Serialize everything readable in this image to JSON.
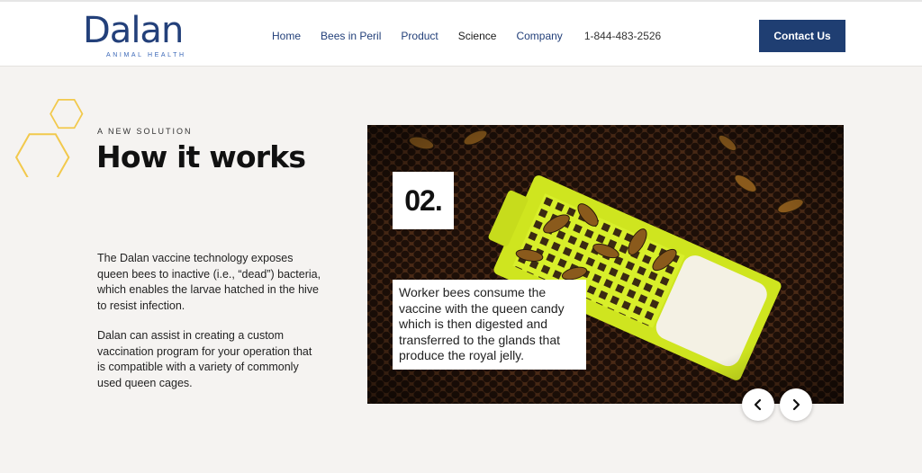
{
  "brand": {
    "name": "Dalan",
    "tagline": "ANIMAL HEALTH",
    "color": "#23407a"
  },
  "nav": {
    "items": [
      "Home",
      "Bees in Peril",
      "Product",
      "Science",
      "Company"
    ],
    "phone": "1-844-483-2526",
    "contact_label": "Contact Us"
  },
  "hero": {
    "eyebrow": "A NEW SOLUTION",
    "title": "How it works",
    "paragraphs": [
      "The Dalan vaccine technology exposes queen bees to inactive (i.e., “dead”) bacteria, which enables the larvae hatched in the hive to resist infection.",
      "Dalan can assist in creating a custom vaccination program for your operation that is compatible with a variety of commonly used queen cages."
    ]
  },
  "slider": {
    "step": "02.",
    "caption": "Worker bees consume the vaccine with the queen candy which is then digested and transferred to the glands that produce the royal jelly."
  },
  "colors": {
    "accent": "#1f3e72",
    "hexagon": "#f2c94c",
    "background": "#f5f3f1"
  },
  "icons": {
    "prev": "chevron-left-icon",
    "next": "chevron-right-icon"
  }
}
